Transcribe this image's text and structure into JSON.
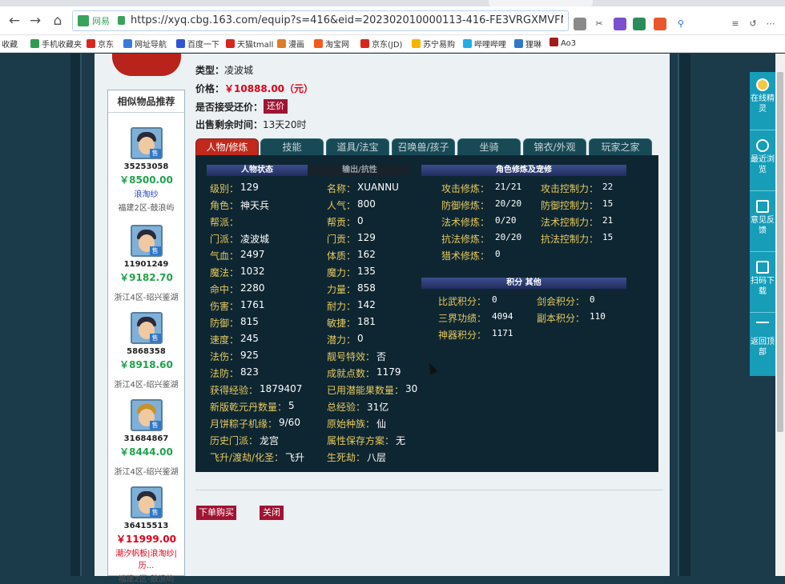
{
  "browser": {
    "address": {
      "site_badge": "网易",
      "url": "https://xyq.cbg.163.com/equip?s=416&eid=202302010000113-416-FE3VRGXMVFMX"
    },
    "bookmarks": [
      "收藏",
      "手机收藏夹",
      "京东",
      "网址导航",
      "百度一下",
      "天猫tmall",
      "漫画",
      "淘宝网",
      "京东(JD)",
      "苏宁易购",
      "哔哩哔哩",
      "狸琳",
      "Ao3"
    ]
  },
  "similar": {
    "title": "相似物品推荐",
    "items": [
      {
        "id": "35253058",
        "price": "￥8500.00",
        "sub": "浪淘纱",
        "server": "福建2区-鼓浪屿"
      },
      {
        "id": "11901249",
        "price": "￥9182.70",
        "sub": "",
        "server": "浙江4区-绍兴鉴湖"
      },
      {
        "id": "5868358",
        "price": "￥8918.60",
        "sub": "",
        "server": "浙江4区-绍兴鉴湖"
      },
      {
        "id": "31684867",
        "price": "￥8444.00",
        "sub": "",
        "server": "浙江4区-绍兴鉴湖"
      },
      {
        "id": "36415513",
        "price": "￥11999.00",
        "sub": "潮汐帆板|浪淘纱|历...",
        "server": "福建2区-鼓浪屿"
      }
    ]
  },
  "info": {
    "type_label": "类型：",
    "type_value": "凌波城",
    "price_label": "价格：",
    "price_value": "￥10888.00（元）",
    "bargain_label": "是否接受还价：",
    "bargain_btn": "还价",
    "time_label": "出售剩余时间：",
    "time_value": "13天20时"
  },
  "tabs": [
    "人物/修炼",
    "技能",
    "道具/法宝",
    "召唤兽/孩子",
    "坐骑",
    "锦衣/外观",
    "玩家之家"
  ],
  "panel": {
    "h_status": "人物状态",
    "h_output": "输出/抗性",
    "h_cultivation": "角色修炼及宠修",
    "h_points": "积分 其他",
    "col1": [
      [
        "级别：",
        "129"
      ],
      [
        "角色：",
        "神天兵"
      ],
      [
        "帮派：",
        ""
      ],
      [
        "门派：",
        "凌波城"
      ],
      [
        "气血：",
        "2497"
      ],
      [
        "魔法：",
        "1032"
      ],
      [
        "命中：",
        "2280"
      ],
      [
        "伤害：",
        "1761"
      ],
      [
        "防御：",
        "815"
      ],
      [
        "速度：",
        "245"
      ],
      [
        "法伤：",
        "925"
      ],
      [
        "法防：",
        "823"
      ],
      [
        "获得经验：",
        "1879407"
      ],
      [
        "新版乾元丹数量：",
        "5"
      ],
      [
        "月饼粽子机缘：",
        "9/60"
      ],
      [
        "历史门派：",
        "龙宫"
      ],
      [
        "飞升/渡劫/化圣：",
        "飞升"
      ]
    ],
    "col2": [
      [
        "名称：",
        "XUANNU"
      ],
      [
        "人气：",
        "800"
      ],
      [
        "帮贡：",
        "0"
      ],
      [
        "门贡：",
        "129"
      ],
      [
        "体质：",
        "162"
      ],
      [
        "魔力：",
        "135"
      ],
      [
        "力量：",
        "858"
      ],
      [
        "耐力：",
        "142"
      ],
      [
        "敏捷：",
        "181"
      ],
      [
        "潜力：",
        "0"
      ],
      [
        "靓号特效：",
        "否"
      ],
      [
        "成就点数：",
        "1179"
      ],
      [
        "已用潜能果数量：",
        "30"
      ],
      [
        "总经验：",
        "31亿"
      ],
      [
        "原始种族：",
        "仙"
      ],
      [
        "属性保存方案：",
        "无"
      ],
      [
        "生死劫：",
        "八层"
      ]
    ],
    "cult_left": [
      [
        "攻击修炼：",
        "21/21"
      ],
      [
        "防御修炼：",
        "20/20"
      ],
      [
        "法术修炼：",
        "0/20"
      ],
      [
        "抗法修炼：",
        "20/20"
      ],
      [
        "猎术修炼：",
        "0"
      ]
    ],
    "cult_right": [
      [
        "攻击控制力：",
        "22"
      ],
      [
        "防御控制力：",
        "15"
      ],
      [
        "法术控制力：",
        "21"
      ],
      [
        "抗法控制力：",
        "15"
      ]
    ],
    "points_left": [
      [
        "比武积分：",
        "0"
      ],
      [
        "三界功绩：",
        "4094"
      ],
      [
        "神器积分：",
        "1171"
      ]
    ],
    "points_right": [
      [
        "剑会积分：",
        "0"
      ],
      [
        "副本积分：",
        "110"
      ]
    ]
  },
  "actions": {
    "buy": "下单购买",
    "close": "关闭"
  },
  "right_sidebar": [
    {
      "label": "在线精灵",
      "icon": "sprite-icon"
    },
    {
      "label": "最近浏览",
      "icon": "clock-icon"
    },
    {
      "label": "意见反馈",
      "icon": "edit-icon"
    },
    {
      "label": "扫码下载",
      "icon": "scan-icon"
    },
    {
      "label": "返回顶部",
      "icon": "arrow-up-icon"
    }
  ]
}
